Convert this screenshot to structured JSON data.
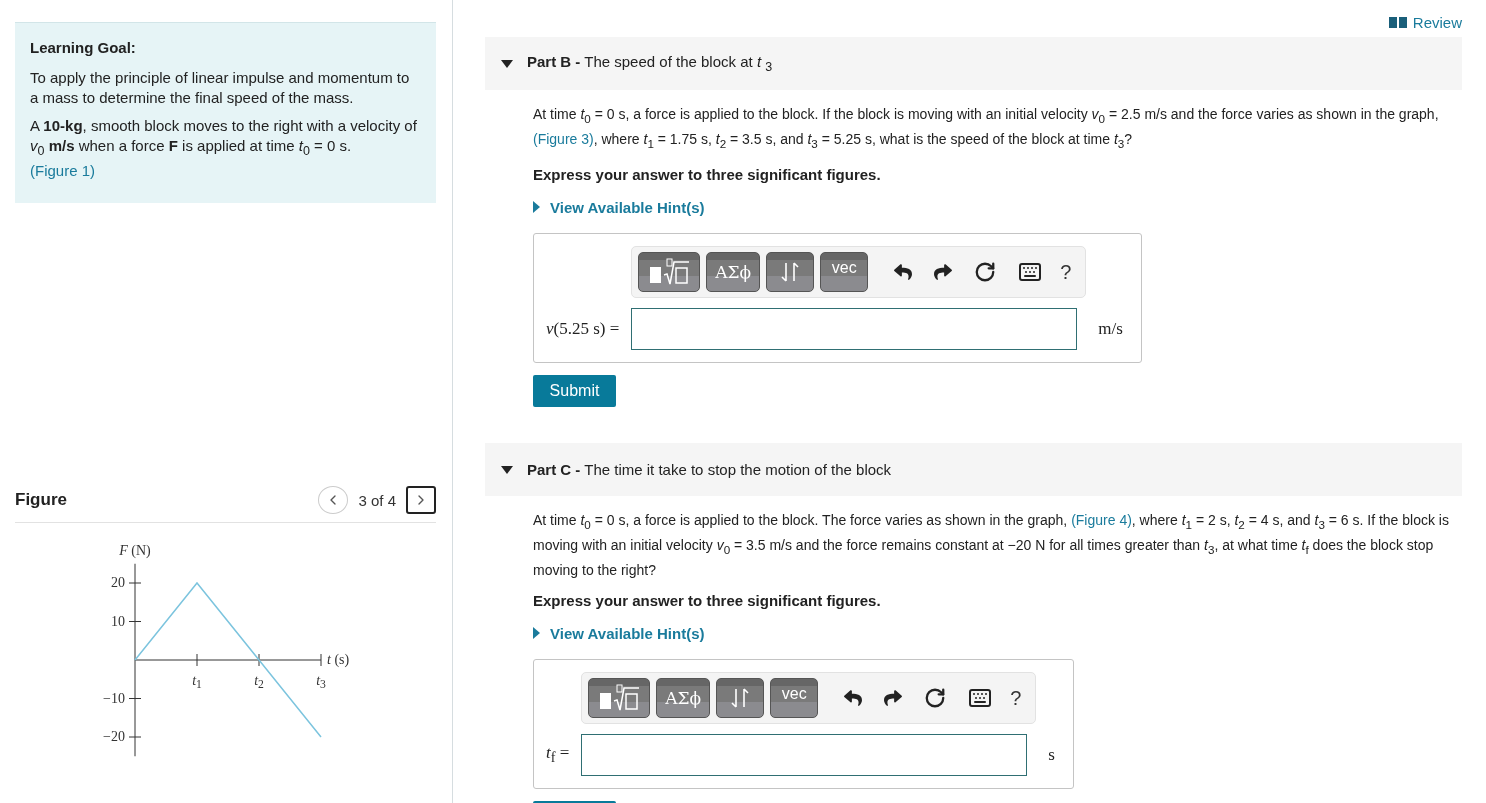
{
  "header": {
    "review_link": "Review"
  },
  "learning_goal": {
    "title": "Learning Goal:",
    "paragraphs": [
      [
        {
          "kind": "text",
          "text": "To apply the principle of linear impulse and momentum to a mass to determine the final speed of the mass."
        }
      ],
      [
        {
          "kind": "text",
          "text": "A **10-kg**, smooth block moves to the right with a velocity of *v*$_{0}$ **m/s** when a force **F** is applied at time *t*$_{0}$ = 0 s. "
        },
        {
          "kind": "link",
          "text": "(Figure 1)"
        }
      ]
    ]
  },
  "figure": {
    "title": "Figure",
    "pager": "3 of 4",
    "prev_focused": false,
    "next_focused": true,
    "chart_data": {
      "type": "line",
      "xlabel": "*t* (s)",
      "ylabel": "*F* (N)",
      "x": [
        0,
        1,
        2,
        3
      ],
      "series": [
        {
          "color": "#7cc4de",
          "values": [
            0,
            20,
            0,
            -20
          ]
        }
      ],
      "xlim": [
        0,
        3
      ],
      "ylim": [
        -25,
        25
      ],
      "yticks": [
        {
          "value": 20,
          "label": "20"
        },
        {
          "value": 10,
          "label": "10"
        },
        {
          "value": -10,
          "label": "−10"
        },
        {
          "value": -20,
          "label": "−20"
        }
      ],
      "xticks": [
        {
          "value": 1,
          "label": "*t*$_{1}$"
        },
        {
          "value": 2,
          "label": "*t*$_{2}$"
        },
        {
          "value": 3,
          "label": "*t*$_{3}$"
        }
      ]
    }
  },
  "parts": [
    {
      "title_prefix": "Part B -",
      "title": "The speed of the block at *t* $_{3}$",
      "expanded": true,
      "prompt": [
        {
          "kind": "text",
          "text": "At time *t*$_{0}$ = 0 s, a force is applied to the block. If the block is moving with an initial velocity *v*$_{0}$ = 2.5 m/s and the force varies as shown in the graph, "
        },
        {
          "kind": "link",
          "text": "(Figure 3)"
        },
        {
          "kind": "text",
          "text": ", where *t*$_{1}$ = 1.75 s, *t*$_{2}$ = 3.5 s, and *t*$_{3}$ = 5.25 s, what is the speed of the block at time *t*$_{3}$?"
        }
      ],
      "instruction": "Express your answer to three significant figures.",
      "hint_link": "View Available Hint(s)",
      "toolbar": {
        "symbols": "ΑΣϕ",
        "vector": "vec",
        "help": "?"
      },
      "answer_label": "*v*(5.25 s) =",
      "unit": "m/s",
      "submit": "Submit"
    },
    {
      "title_prefix": "Part C -",
      "title": "The time it take to stop the motion of the block",
      "expanded": true,
      "prompt": [
        {
          "kind": "text",
          "text": "At time *t*$_{0}$ = 0 s, a force is applied to the block. The force varies as shown in the graph, "
        },
        {
          "kind": "link",
          "text": "(Figure 4)"
        },
        {
          "kind": "text",
          "text": ", where *t*$_{1}$ = 2 s, *t*$_{2}$ = 4 s, and *t*$_{3}$ = 6 s. If the block is moving with an initial velocity *v*$_{0}$ = 3.5 m/s and the force remains constant at −20 N for all times greater than *t*$_{3}$, at what time *t*$_{f}$ does the block stop moving to the right?"
        }
      ],
      "instruction": "Express your answer to three significant figures.",
      "hint_link": "View Available Hint(s)",
      "toolbar": {
        "symbols": "ΑΣϕ",
        "vector": "vec",
        "help": "?"
      },
      "answer_label": "*t*$_{f}$ =",
      "unit": "s"
    }
  ]
}
